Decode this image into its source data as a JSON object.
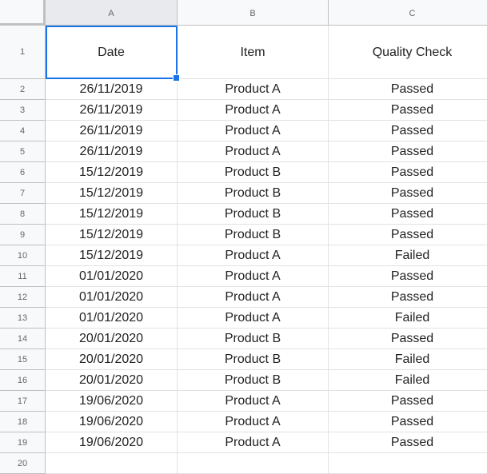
{
  "sheet": {
    "columns": [
      "A",
      "B",
      "C"
    ],
    "selected_cell": "A1",
    "header_row": [
      "Date",
      "Item",
      "Quality Check"
    ],
    "rows": [
      {
        "n": "2",
        "cells": [
          "26/11/2019",
          "Product A",
          "Passed"
        ]
      },
      {
        "n": "3",
        "cells": [
          "26/11/2019",
          "Product A",
          "Passed"
        ]
      },
      {
        "n": "4",
        "cells": [
          "26/11/2019",
          "Product A",
          "Passed"
        ]
      },
      {
        "n": "5",
        "cells": [
          "26/11/2019",
          "Product A",
          "Passed"
        ]
      },
      {
        "n": "6",
        "cells": [
          "15/12/2019",
          "Product B",
          "Passed"
        ]
      },
      {
        "n": "7",
        "cells": [
          "15/12/2019",
          "Product B",
          "Passed"
        ]
      },
      {
        "n": "8",
        "cells": [
          "15/12/2019",
          "Product B",
          "Passed"
        ]
      },
      {
        "n": "9",
        "cells": [
          "15/12/2019",
          "Product B",
          "Passed"
        ]
      },
      {
        "n": "10",
        "cells": [
          "15/12/2019",
          "Product A",
          "Failed"
        ]
      },
      {
        "n": "11",
        "cells": [
          "01/01/2020",
          "Product A",
          "Passed"
        ]
      },
      {
        "n": "12",
        "cells": [
          "01/01/2020",
          "Product A",
          "Passed"
        ]
      },
      {
        "n": "13",
        "cells": [
          "01/01/2020",
          "Product A",
          "Failed"
        ]
      },
      {
        "n": "14",
        "cells": [
          "20/01/2020",
          "Product B",
          "Passed"
        ]
      },
      {
        "n": "15",
        "cells": [
          "20/01/2020",
          "Product B",
          "Failed"
        ]
      },
      {
        "n": "16",
        "cells": [
          "20/01/2020",
          "Product B",
          "Failed"
        ]
      },
      {
        "n": "17",
        "cells": [
          "19/06/2020",
          "Product A",
          "Passed"
        ]
      },
      {
        "n": "18",
        "cells": [
          "19/06/2020",
          "Product A",
          "Passed"
        ]
      },
      {
        "n": "19",
        "cells": [
          "19/06/2020",
          "Product A",
          "Passed"
        ]
      },
      {
        "n": "20",
        "cells": [
          "",
          "",
          ""
        ]
      }
    ],
    "header_row_number": "1",
    "accent_color": "#1a73e8"
  }
}
